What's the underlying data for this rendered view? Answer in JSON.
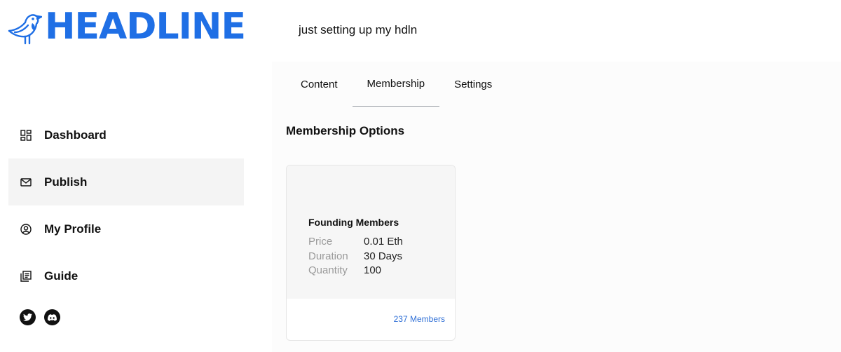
{
  "brand": {
    "name": "HEADLINE",
    "color": "#1f6fe5"
  },
  "tagline": "just setting up my hdln",
  "tabs": [
    {
      "label": "Content",
      "active": false
    },
    {
      "label": "Membership",
      "active": true
    },
    {
      "label": "Settings",
      "active": false
    }
  ],
  "section_title": "Membership Options",
  "sidebar": {
    "items": [
      {
        "label": "Dashboard",
        "icon": "grid-icon",
        "active": false
      },
      {
        "label": "Publish",
        "icon": "envelope-icon",
        "active": true
      },
      {
        "label": "My Profile",
        "icon": "user-circle-icon",
        "active": false
      },
      {
        "label": "Guide",
        "icon": "book-icon",
        "active": false
      }
    ],
    "social": [
      {
        "icon": "twitter-icon"
      },
      {
        "icon": "discord-icon"
      }
    ]
  },
  "membership_card": {
    "title": "Founding Members",
    "rows": [
      {
        "key": "Price",
        "value": "0.01 Eth"
      },
      {
        "key": "Duration",
        "value": "30 Days"
      },
      {
        "key": "Quantity",
        "value": "100"
      }
    ],
    "members_link": "237 Members"
  },
  "colors": {
    "accent": "#1f6fe5",
    "link": "#2f6fd6",
    "sidebar_active_bg": "#f4f4f4"
  }
}
